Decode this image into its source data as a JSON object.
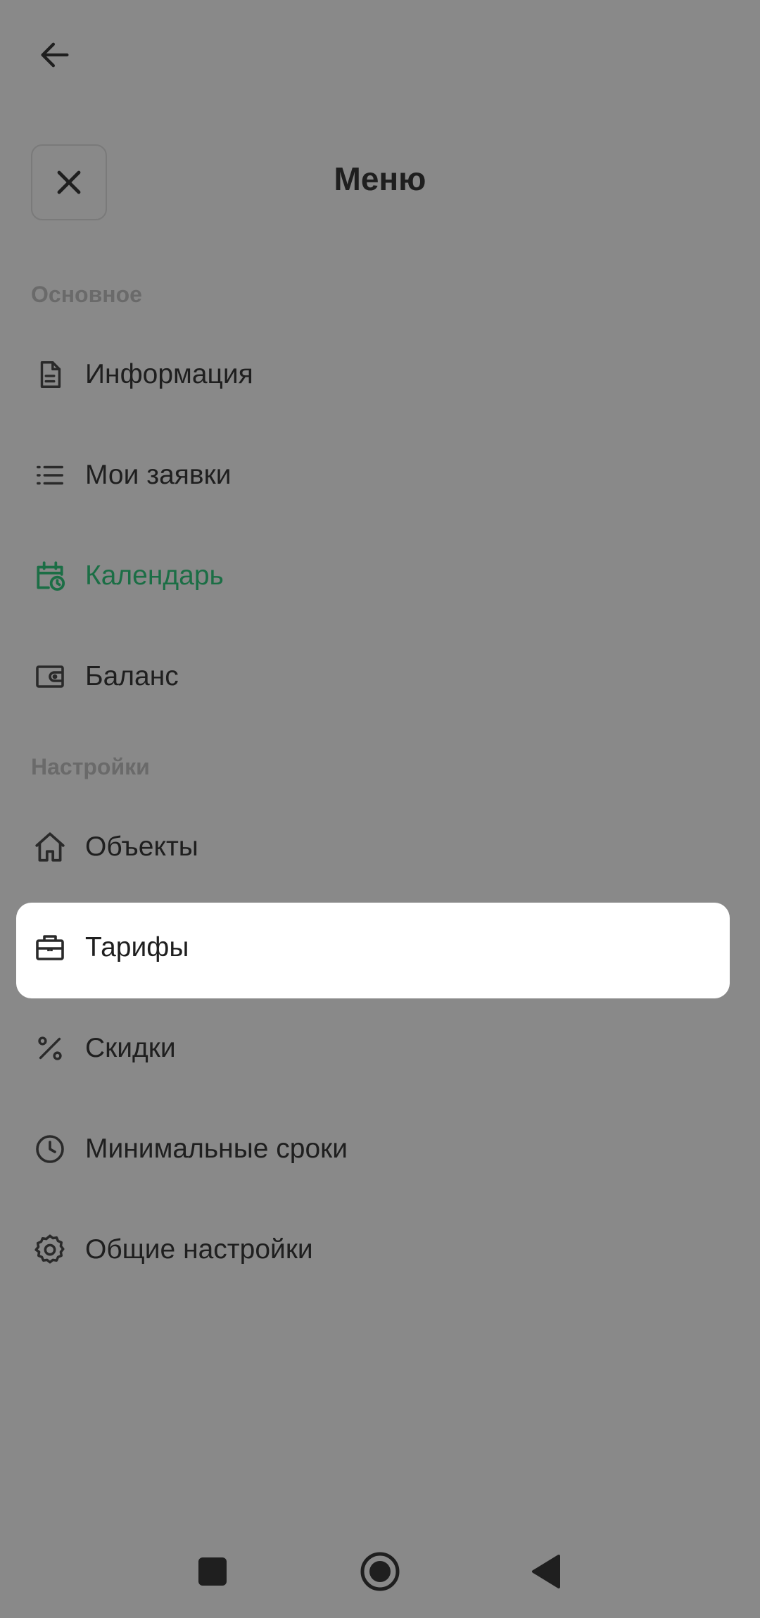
{
  "header": {
    "title": "Меню"
  },
  "sections": [
    {
      "label": "Основное",
      "items": [
        {
          "label": "Информация",
          "icon": "document-icon"
        },
        {
          "label": "Мои заявки",
          "icon": "list-icon"
        },
        {
          "label": "Календарь",
          "icon": "calendar-clock-icon",
          "active": true
        },
        {
          "label": "Баланс",
          "icon": "wallet-icon"
        }
      ]
    },
    {
      "label": "Настройки",
      "items": [
        {
          "label": "Объекты",
          "icon": "home-icon"
        },
        {
          "label": "Тарифы",
          "icon": "briefcase-icon",
          "highlighted": true
        },
        {
          "label": "Скидки",
          "icon": "percent-icon"
        },
        {
          "label": "Минимальные сроки",
          "icon": "clock-icon"
        },
        {
          "label": "Общие настройки",
          "icon": "gear-icon"
        }
      ]
    }
  ],
  "colors": {
    "background": "#898989",
    "accent": "#1b6e45",
    "text": "#1f1f1f",
    "section_label": "#6a6a6a",
    "highlight": "#ffffff"
  },
  "system_nav": {
    "icons": [
      "square-icon",
      "home-circle-icon",
      "back-triangle-icon"
    ]
  }
}
